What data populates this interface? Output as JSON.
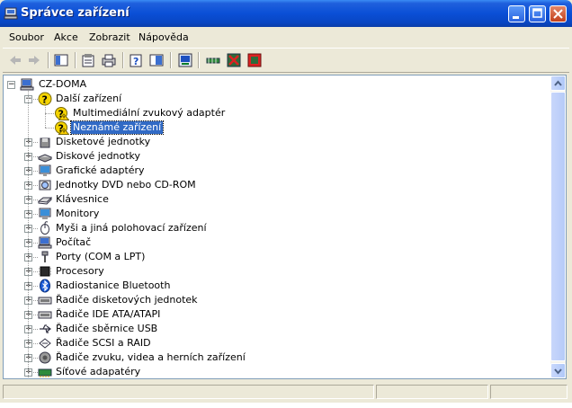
{
  "window": {
    "title": "Správce zařízení"
  },
  "menu": [
    "Soubor",
    "Akce",
    "Zobrazit",
    "Nápověda"
  ],
  "tree": {
    "root": "CZ-DOMA",
    "items": [
      {
        "label": "Další zařízení",
        "icon": "unknown-device-icon",
        "expanded": true,
        "children": [
          {
            "label": "Multimediální zvukový adaptér",
            "icon": "warning-device-icon"
          },
          {
            "label": "Neznámé zařízení",
            "icon": "warning-device-icon",
            "selected": true
          }
        ]
      },
      {
        "label": "Disketové jednotky",
        "icon": "floppy-drive-icon"
      },
      {
        "label": "Diskové jednotky",
        "icon": "hard-disk-icon"
      },
      {
        "label": "Grafické adaptéry",
        "icon": "display-adapter-icon"
      },
      {
        "label": "Jednotky DVD nebo CD-ROM",
        "icon": "cdrom-icon"
      },
      {
        "label": "Klávesnice",
        "icon": "keyboard-icon"
      },
      {
        "label": "Monitory",
        "icon": "monitor-icon"
      },
      {
        "label": "Myši a jiná polohovací zařízení",
        "icon": "mouse-icon"
      },
      {
        "label": "Počítač",
        "icon": "computer-icon"
      },
      {
        "label": "Porty (COM a LPT)",
        "icon": "port-icon"
      },
      {
        "label": "Procesory",
        "icon": "processor-icon"
      },
      {
        "label": "Radiostanice Bluetooth",
        "icon": "bluetooth-icon"
      },
      {
        "label": "Řadiče disketových jednotek",
        "icon": "controller-icon"
      },
      {
        "label": "Řadiče IDE ATA/ATAPI",
        "icon": "controller-icon"
      },
      {
        "label": "Řadiče sběrnice USB",
        "icon": "usb-icon"
      },
      {
        "label": "Řadiče SCSI a RAID",
        "icon": "scsi-icon"
      },
      {
        "label": "Řadiče zvuku, videa a herních zařízení",
        "icon": "sound-icon"
      },
      {
        "label": "Síťové adapatéry",
        "icon": "network-adapter-icon"
      }
    ]
  },
  "colors": {
    "titlebar": "#0a4fd6",
    "selection": "#316ac5",
    "warning": "#f5d400"
  }
}
